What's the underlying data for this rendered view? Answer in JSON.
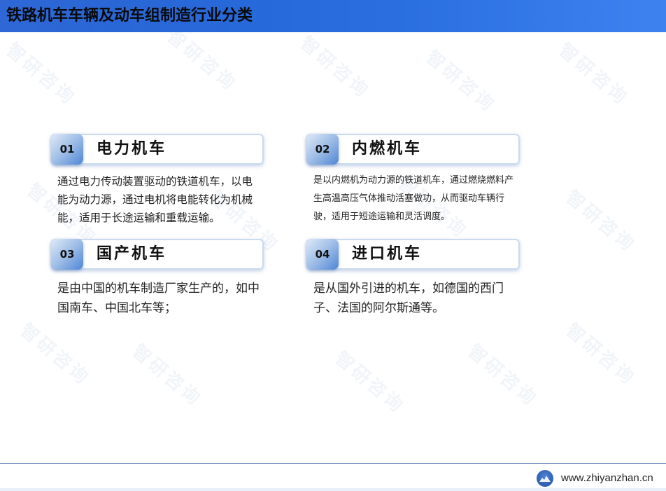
{
  "title": "铁路机车车辆及动车组制造行业分类",
  "cards": [
    {
      "num": "01",
      "label": "电力机车",
      "desc": "通过电力传动装置驱动的铁道机车，以电能为动力源，通过电机将电能转化为机械能，适用于长途运输和重载运输。"
    },
    {
      "num": "02",
      "label": "内燃机车",
      "desc": "是以内燃机为动力源的铁道机车，通过燃烧燃料产生高温高压气体推动活塞做功，从而驱动车辆行驶，适用于短途运输和灵活调度。"
    },
    {
      "num": "03",
      "label": "国产机车",
      "desc": "是由中国的机车制造厂家生产的，如中国南车、中国北车等；"
    },
    {
      "num": "04",
      "label": "进口机车",
      "desc": "是从国外引进的机车，如德国的西门子、法国的阿尔斯通等。"
    }
  ],
  "watermark": "智研咨询",
  "footer": {
    "site": "www.zhiyanzhan.cn",
    "logo_icon": "zhiyan-logo-icon"
  },
  "colors": {
    "title_bar": "#2a6fe0",
    "badge": "#4f86d6",
    "card_border": "#c9daf1"
  }
}
